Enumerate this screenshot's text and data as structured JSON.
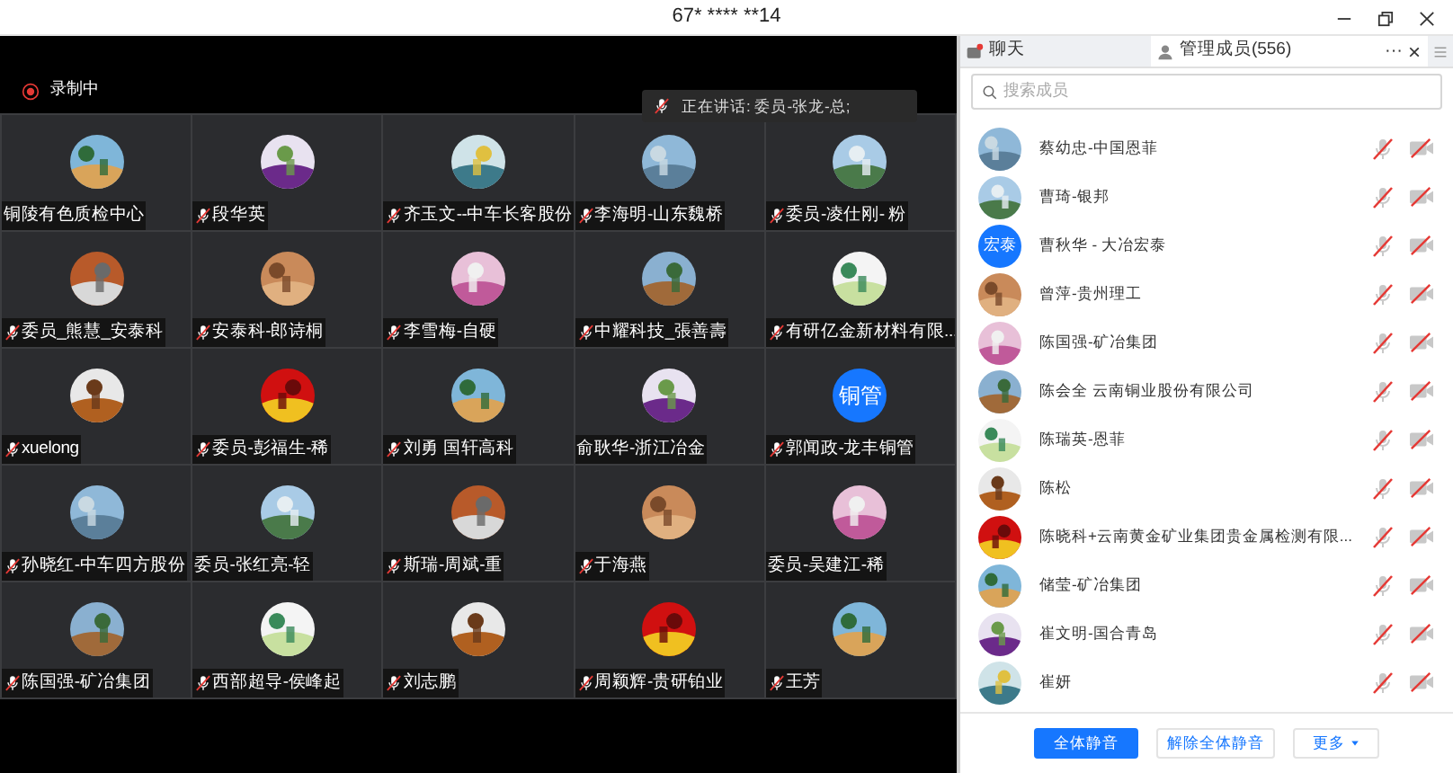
{
  "window": {
    "title": "67* **** **14"
  },
  "recording": {
    "label": "录制中"
  },
  "speaking": {
    "text": "正在讲话: 委员-张龙-总;"
  },
  "tiles": [
    {
      "name": "铜陵有色质检中心",
      "muted": false
    },
    {
      "name": "段华英",
      "muted": true
    },
    {
      "name": "齐玉文--中车长客股份",
      "muted": true
    },
    {
      "name": "李海明-山东魏桥",
      "muted": true
    },
    {
      "name": "委员-凌仕刚- 粉",
      "muted": true
    },
    {
      "name": "委员_熊慧_安泰科",
      "muted": true
    },
    {
      "name": "安泰科-郎诗桐",
      "muted": true
    },
    {
      "name": "李雪梅-自硬",
      "muted": true
    },
    {
      "name": "中耀科技_張善壽",
      "muted": true
    },
    {
      "name": "有研亿金新材料有限...",
      "muted": true
    },
    {
      "name": "xuelong",
      "muted": true
    },
    {
      "name": "委员-彭福生-稀",
      "muted": true
    },
    {
      "name": "刘勇 国轩高科",
      "muted": true
    },
    {
      "name": "俞耿华-浙江冶金",
      "muted": false
    },
    {
      "name": "郭闻政-龙丰铜管",
      "muted": true,
      "avatar": {
        "kind": "text",
        "text": "铜管"
      }
    },
    {
      "name": "孙晓红-中车四方股份",
      "muted": true
    },
    {
      "name": "委员-张红亮-轻",
      "muted": false
    },
    {
      "name": "斯瑞-周斌-重",
      "muted": true
    },
    {
      "name": "于海燕",
      "muted": true
    },
    {
      "name": "委员-吴建江-稀",
      "muted": false
    },
    {
      "name": "陈国强-矿冶集团",
      "muted": true
    },
    {
      "name": "西部超导-侯峰起",
      "muted": true
    },
    {
      "name": "刘志鹏",
      "muted": true
    },
    {
      "name": "周颖辉-贵研铂业",
      "muted": true
    },
    {
      "name": "王芳",
      "muted": true
    }
  ],
  "panel": {
    "tabs": [
      {
        "label": "聊天",
        "selected": false,
        "unread": true
      },
      {
        "label": "管理成员(556)",
        "selected": true,
        "unread": false
      }
    ],
    "more": "···",
    "close": "×",
    "search": {
      "placeholder": "搜索成员"
    },
    "members": [
      {
        "name": "蔡幼忠-中国恩菲"
      },
      {
        "name": "曹琦-银邦"
      },
      {
        "name": "曹秋华 - 大冶宏泰",
        "avatar": {
          "kind": "text",
          "text": "宏泰"
        }
      },
      {
        "name": "曾萍-贵州理工"
      },
      {
        "name": "陈国强-矿冶集团"
      },
      {
        "name": "陈会全  云南铜业股份有限公司"
      },
      {
        "name": "陈瑞英-恩菲"
      },
      {
        "name": "陈松"
      },
      {
        "name": "陈晓科+云南黄金矿业集团贵金属检测有限..."
      },
      {
        "name": "储莹-矿冶集团"
      },
      {
        "name": "崔文明-国合青岛"
      },
      {
        "name": "崔妍"
      }
    ],
    "buttons": [
      {
        "label": "全体静音",
        "kind": "primary"
      },
      {
        "label": "解除全体静音",
        "kind": "secondary"
      },
      {
        "label": "更多",
        "kind": "menu"
      }
    ]
  }
}
